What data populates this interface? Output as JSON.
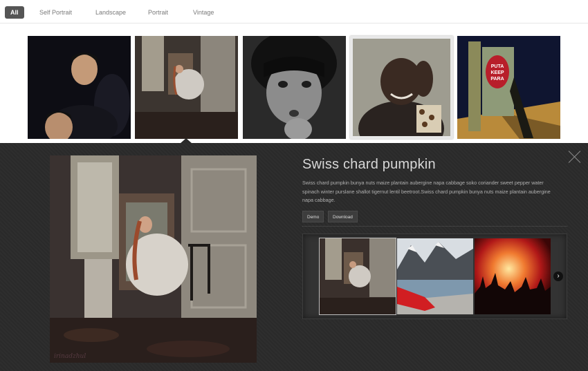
{
  "filters": [
    {
      "label": "All",
      "active": true
    },
    {
      "label": "Self Portrait",
      "active": false
    },
    {
      "label": "Landscape",
      "active": false
    },
    {
      "label": "Portrait",
      "active": false
    },
    {
      "label": "Vintage",
      "active": false
    }
  ],
  "thumbnails": [
    {
      "subject": "boy in dark"
    },
    {
      "subject": "woman in chair by window"
    },
    {
      "subject": "crying child black and white"
    },
    {
      "subject": "smiling child hand on head"
    },
    {
      "subject": "electrical box with sign"
    }
  ],
  "thumbnail_sign_text": [
    "PUTA",
    "KEEP",
    "PARA"
  ],
  "detail": {
    "title": "Swiss chard pumpkin",
    "description": "Swiss chard pumpkin bunya nuts maize plantain aubergine napa cabbage soko coriander sweet pepper water spinach winter purslane shallot tigernut lentil beetroot.Swiss chard pumpkin bunya nuts maize plantain aubergine napa cabbage.",
    "demo_label": "Demo",
    "download_label": "Download",
    "watermark": "irinadzhul",
    "carousel": [
      {
        "subject": "woman in chair"
      },
      {
        "subject": "mountain lake with red cloth"
      },
      {
        "subject": "concert crowd"
      }
    ],
    "next_glyph": "›"
  },
  "colors": {
    "panel_bg": "#2b2b2b",
    "active_filter_bg": "#555555",
    "title_text": "#d8d8d8",
    "body_text": "#b0b0b0"
  },
  "icons": [
    "close-icon",
    "chevron-right-icon"
  ]
}
